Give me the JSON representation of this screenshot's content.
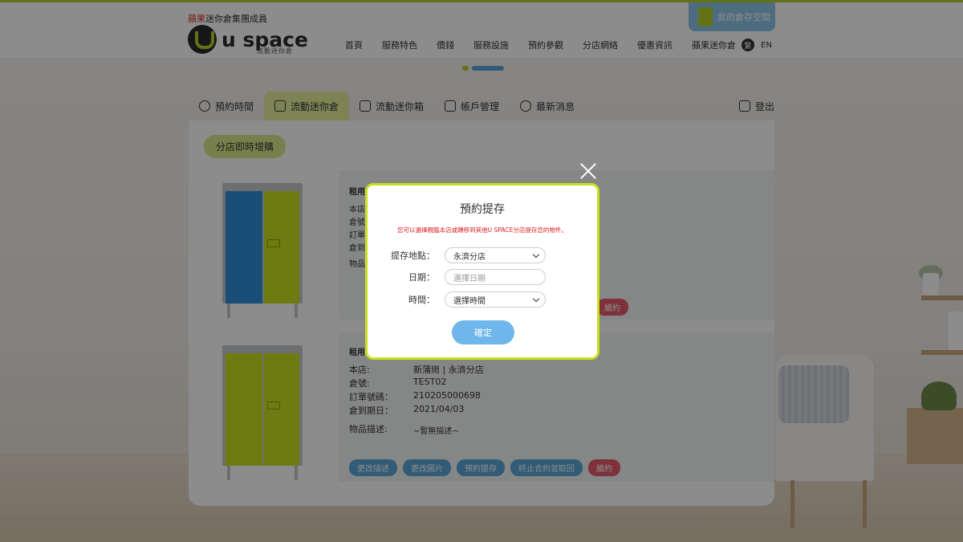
{
  "header": {
    "brand_red": "蘋果",
    "brand_rest": "迷你倉集團成員",
    "logo_text": "u space",
    "logo_sub": "流動迷你倉",
    "my_storage": "我的倉存空間",
    "nav": [
      "首頁",
      "服務特色",
      "價錢",
      "服務設施",
      "預約參觀",
      "分店網絡",
      "優惠資訊",
      "蘋果迷你倉"
    ],
    "lang_active": "繁",
    "lang_other": "EN"
  },
  "tabs": {
    "items": [
      "預約時間",
      "流動迷你倉",
      "流動迷你箱",
      "帳戶管理",
      "最新消息"
    ],
    "logout": "登出"
  },
  "main": {
    "add_button": "分店即時增購",
    "row1_label": "租用",
    "row1_cancel": "續約",
    "row2": {
      "label": "租用",
      "fields": [
        {
          "k": "本店:",
          "v": "新蒲崗 | 永濟分店"
        },
        {
          "k": "倉號:",
          "v": "TEST02"
        },
        {
          "k": "訂單號碼：",
          "v": "210205000698"
        },
        {
          "k": "倉到期日：",
          "v": "2021/04/03"
        }
      ],
      "desc_label": "物品描述:",
      "desc_value": "~暫無描述~",
      "buttons": [
        "更改描述",
        "更改圖片",
        "預約提存",
        "終止合約並取回",
        "續約"
      ]
    },
    "row1_fields": [
      "本店",
      "倉號",
      "訂單",
      "倉到",
      "物品"
    ]
  },
  "modal": {
    "title": "預約提存",
    "note": "您可以選擇親臨本店或轉移到其他U SPACE分店提存您的物件。",
    "location_label": "提存地點：",
    "location_value": "永濟分店",
    "date_label": "日期：",
    "date_placeholder": "選擇日期",
    "time_label": "時間：",
    "time_value": "選擇時間",
    "confirm": "確定"
  },
  "colors": {
    "accent_green": "#c8e01e",
    "accent_blue": "#5aa6d8",
    "cancel_red": "#e55a6a",
    "note_red": "#e02020"
  }
}
